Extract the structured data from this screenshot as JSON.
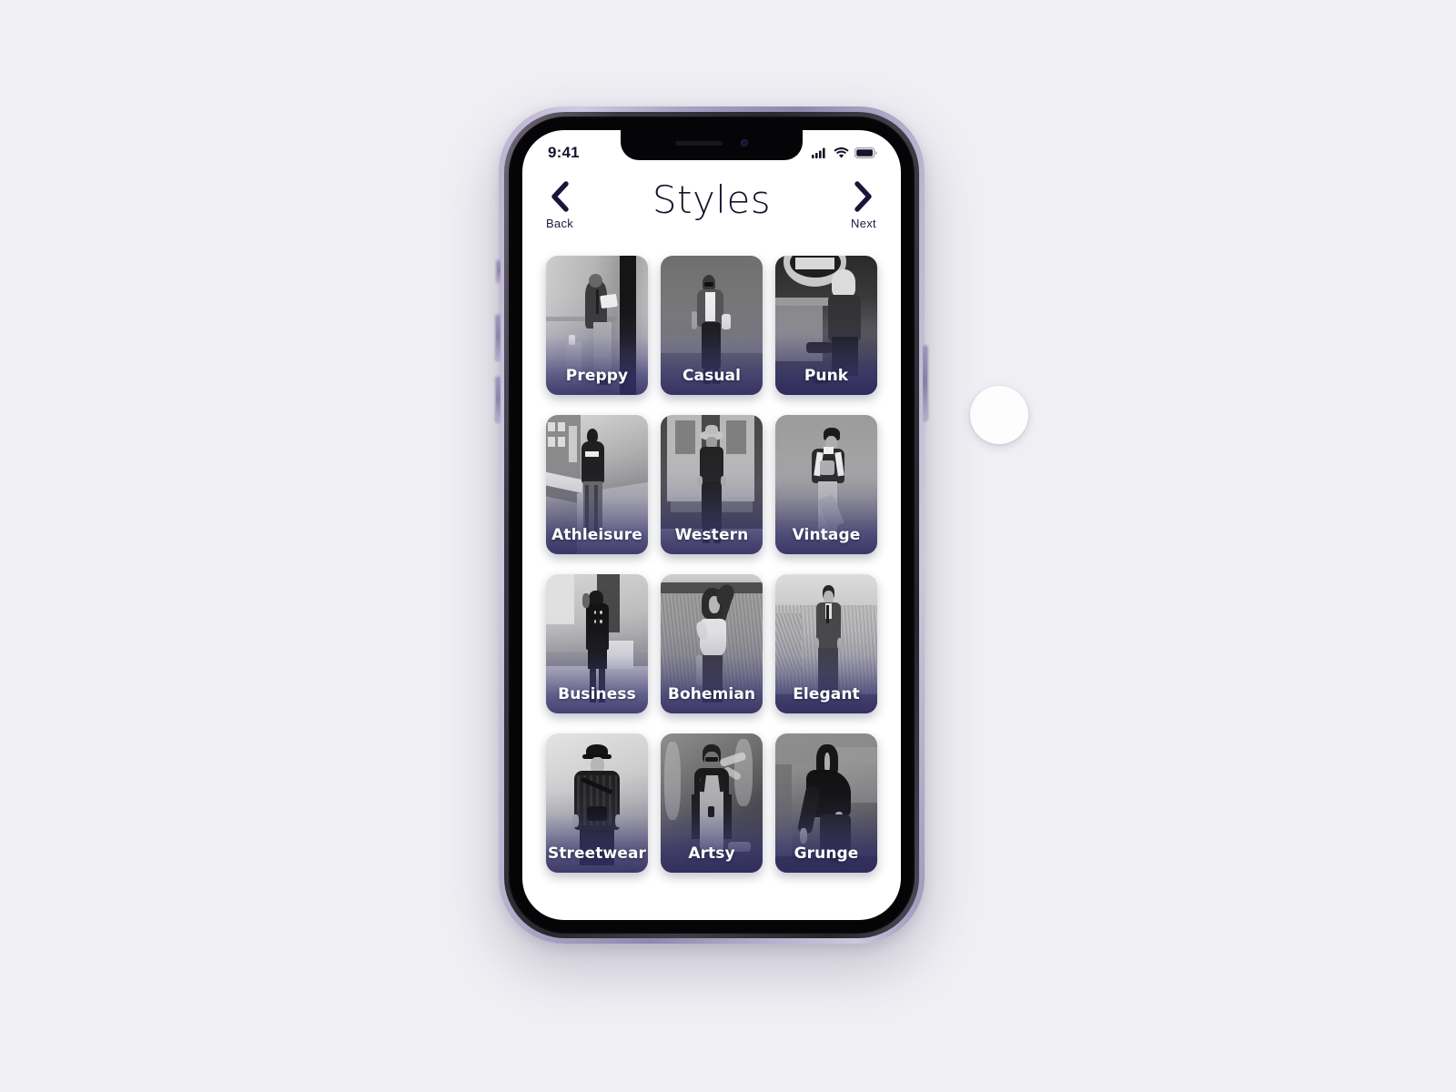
{
  "canvas": {
    "background": "#f0eff4"
  },
  "device": {
    "frame_color": "#b0a9c8",
    "buttons": [
      "silent-switch",
      "volume-up",
      "volume-down",
      "power"
    ]
  },
  "status_bar": {
    "time": "9:41",
    "icons": [
      "cellular-signal-icon",
      "wifi-icon",
      "battery-icon"
    ]
  },
  "header": {
    "title": "Styles",
    "back": {
      "label": "Back",
      "icon": "chevron-left-icon"
    },
    "next": {
      "label": "Next",
      "icon": "chevron-right-icon"
    }
  },
  "grid": {
    "columns": 3,
    "tiles": [
      {
        "label": "Preppy",
        "scene": "man-in-blazer-reading-book-leaning-on-stone-wall"
      },
      {
        "label": "Casual",
        "scene": "woman-in-denim-jacket-sunglasses-holding-cup"
      },
      {
        "label": "Punk",
        "scene": "person-with-spiked-hair-seated-under-ramen-sign"
      },
      {
        "label": "Athleisure",
        "scene": "person-with-backpack-walking-up-city-steps"
      },
      {
        "label": "Western",
        "scene": "person-in-cowboy-hat-denim-before-wooden-door"
      },
      {
        "label": "Vintage",
        "scene": "person-in-varsity-jacket-and-beret-against-wall"
      },
      {
        "label": "Business",
        "scene": "woman-in-tailored-coat-on-city-sidewalk"
      },
      {
        "label": "Bohemian",
        "scene": "woman-in-off-shoulder-top-in-tall-grass-field"
      },
      {
        "label": "Elegant",
        "scene": "man-in-three-piece-suit-in-reed-field"
      },
      {
        "label": "Streetwear",
        "scene": "man-in-beanie-plaid-jacket-with-sling-bag"
      },
      {
        "label": "Artsy",
        "scene": "man-in-overalls-glasses-before-graffiti-wall"
      },
      {
        "label": "Grunge",
        "scene": "person-crouching-in-dark-leather-in-concrete-room"
      }
    ],
    "overlay_color": "#302c62",
    "label_color": "#ffffff"
  },
  "floating_circle": {
    "name": "floating-action-circle",
    "color": "#fdfdfe"
  }
}
